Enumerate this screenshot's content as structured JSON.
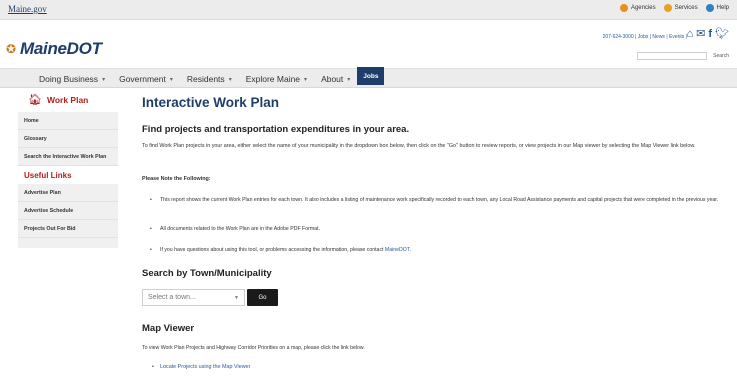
{
  "gov_bar": {
    "logo": "Maine.gov",
    "links": [
      {
        "label": "Agencies",
        "icon": "agencies-icon",
        "color": "#e8901e"
      },
      {
        "label": "Services",
        "icon": "services-icon",
        "color": "#e8a21e"
      },
      {
        "label": "Help",
        "icon": "help-icon",
        "color": "#2f7fc1"
      }
    ]
  },
  "header": {
    "brand": "MaineDOT",
    "contact": "207-624-3000 | Jobs | News | Events |",
    "social_icons": [
      "home-icon",
      "mail-icon",
      "facebook-icon",
      "twitter-icon"
    ],
    "search_label": "Search"
  },
  "nav": {
    "items": [
      {
        "label": "Doing Business",
        "caret": "▾"
      },
      {
        "label": "Government",
        "caret": "▾"
      },
      {
        "label": "Residents",
        "caret": "▾"
      },
      {
        "label": "Explore Maine",
        "caret": "▾"
      },
      {
        "label": "About",
        "caret": "▾"
      },
      {
        "label": "Jobs",
        "caret": ""
      }
    ]
  },
  "sidebar": {
    "title": "Work Plan",
    "items": [
      "Home",
      "Glossary",
      "Search the Interactive Work Plan"
    ],
    "useful_title": "Useful Links",
    "useful_items": [
      "Advertise Plan",
      "Advertise Schedule",
      "Projects Out For Bid"
    ]
  },
  "main": {
    "title": "Interactive Work Plan",
    "subtitle": "Find projects and transportation expenditures in your area.",
    "intro": "To find Work Plan projects in your area, either select the name of your municipality in the dropdown box below, then click on the \"Go\" button to review reports, or view projects in our Map viewer by selecting the Map Viewer link below.",
    "note_head": "Please Note the Following:",
    "bullets": [
      "This report shows the current Work Plan entries for each town. It also includes a listing of maintenance work specifically recorded to each town, any Local Road Assistance payments and capital projects that were completed in the previous year.",
      "All documents related to the Work Plan are in the Adobe PDF Format.",
      "If you have questions about using this tool, or problems accessing the information, please contact "
    ],
    "contact_link": "MaineDOT",
    "search_title": "Search by Town/Municipality",
    "select_placeholder": "Select a town...",
    "go_label": "Go",
    "map_title": "Map Viewer",
    "map_text": "To view Work Plan Projects and Highway Corridor Priorities on a map, please click the link below.",
    "map_link": "Locate Projects using the Map Viewer"
  }
}
